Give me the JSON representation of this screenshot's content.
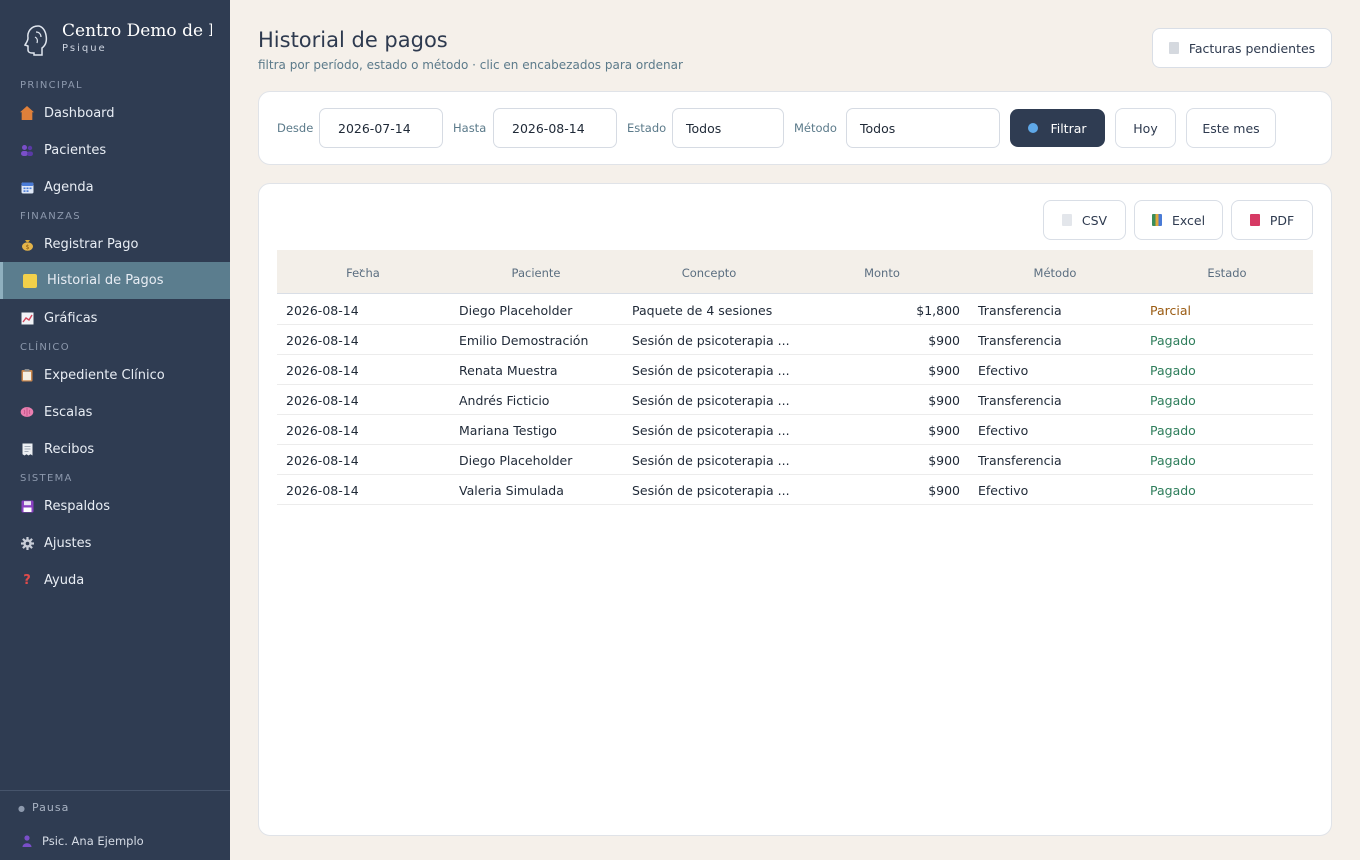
{
  "brand": {
    "title": "Centro Demo de Psicología",
    "subtitle": "Psique"
  },
  "sidebar": {
    "sections": {
      "principal": "PRINCIPAL",
      "finanzas": "FINANZAS",
      "clinico": "CLÍNICO",
      "sistema": "SISTEMA"
    },
    "items": [
      {
        "label": "Dashboard",
        "icon": "house-icon"
      },
      {
        "label": "Pacientes",
        "icon": "people-icon"
      },
      {
        "label": "Agenda",
        "icon": "calendar-icon"
      },
      {
        "label": "Registrar Pago",
        "icon": "money-bag-icon"
      },
      {
        "label": "Historial de Pagos",
        "icon": "notepad-icon"
      },
      {
        "label": "Gráficas",
        "icon": "chart-icon"
      },
      {
        "label": "Expediente Clínico",
        "icon": "clipboard-icon"
      },
      {
        "label": "Escalas",
        "icon": "brain-icon"
      },
      {
        "label": "Recibos",
        "icon": "receipt-icon"
      },
      {
        "label": "Respaldos",
        "icon": "floppy-disk-icon"
      },
      {
        "label": "Ajustes",
        "icon": "gear-icon"
      },
      {
        "label": "Ayuda",
        "icon": "question-icon"
      }
    ],
    "active_item": "Historial de Pagos",
    "footer": {
      "pause": "Pausa",
      "user": "Psic. Ana Ejemplo"
    }
  },
  "header": {
    "title": "Historial de pagos",
    "subtitle": "filtra por período, estado o método · clic en encabezados para ordenar",
    "pending_button": "Facturas pendientes"
  },
  "filters": {
    "desde_label": "Desde",
    "desde_value": "2026-07-14",
    "hasta_label": "Hasta",
    "hasta_value": "2026-08-14",
    "estado_label": "Estado",
    "estado_value": "Todos",
    "metodo_label": "Método",
    "metodo_value": "Todos",
    "filter_button": "Filtrar",
    "today_button": "Hoy",
    "month_button": "Este mes"
  },
  "export": {
    "csv": "CSV",
    "excel": "Excel",
    "pdf": "PDF"
  },
  "table": {
    "columns": [
      "Fecha",
      "Paciente",
      "Concepto",
      "Monto",
      "Método",
      "Estado"
    ],
    "sorted_by": "Fecha",
    "rows": [
      {
        "fecha": "2026-08-14",
        "paciente": "Diego Placeholder",
        "concepto": "Paquete de 4 sesiones",
        "monto": "$1,800",
        "metodo": "Transferencia",
        "estado": "Parcial"
      },
      {
        "fecha": "2026-08-14",
        "paciente": "Emilio Demostración",
        "concepto": "Sesión de psicoterapia ...",
        "monto": "$900",
        "metodo": "Transferencia",
        "estado": "Pagado"
      },
      {
        "fecha": "2026-08-14",
        "paciente": "Renata Muestra",
        "concepto": "Sesión de psicoterapia ...",
        "monto": "$900",
        "metodo": "Efectivo",
        "estado": "Pagado"
      },
      {
        "fecha": "2026-08-14",
        "paciente": "Andrés Ficticio",
        "concepto": "Sesión de psicoterapia ...",
        "monto": "$900",
        "metodo": "Transferencia",
        "estado": "Pagado"
      },
      {
        "fecha": "2026-08-14",
        "paciente": "Mariana Testigo",
        "concepto": "Sesión de psicoterapia ...",
        "monto": "$900",
        "metodo": "Efectivo",
        "estado": "Pagado"
      },
      {
        "fecha": "2026-08-14",
        "paciente": "Diego Placeholder",
        "concepto": "Sesión de psicoterapia ...",
        "monto": "$900",
        "metodo": "Transferencia",
        "estado": "Pagado"
      },
      {
        "fecha": "2026-08-14",
        "paciente": "Valeria Simulada",
        "concepto": "Sesión de psicoterapia ...",
        "monto": "$900",
        "metodo": "Efectivo",
        "estado": "Pagado"
      }
    ]
  },
  "colors": {
    "sidebar_bg": "#2f3c52",
    "active_item_bg": "#5b7d8e",
    "status_paid": "#2e7d5b",
    "status_partial": "#9a5b12",
    "accent_dark": "#2f3c52"
  }
}
